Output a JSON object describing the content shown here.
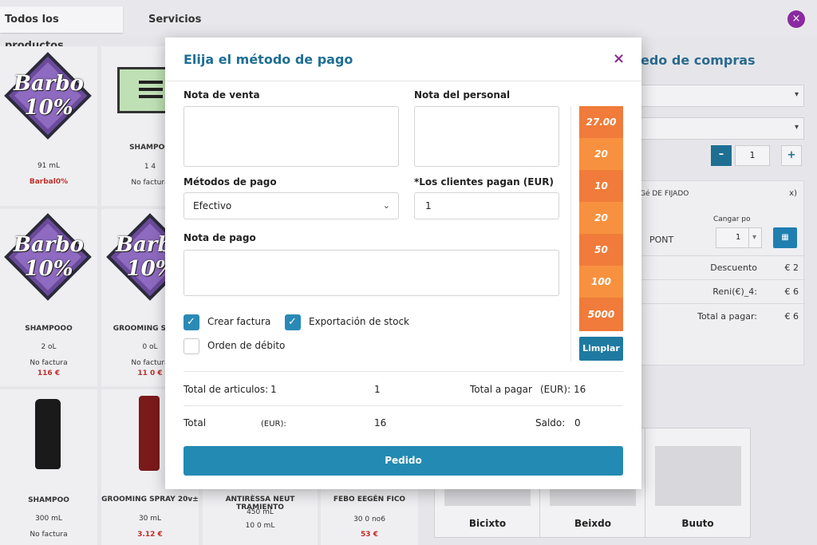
{
  "background": {
    "tabs": [
      "Todos los productos",
      "Servicios"
    ],
    "close_glyph": "×",
    "products": [
      {
        "name": "",
        "logo": "Barbo 10%",
        "size": "91 mL",
        "price": "Barbal0%"
      },
      {
        "name": "SHAMPOO",
        "size": "1 4",
        "note": "No factura"
      },
      {
        "name": "SHAMPOOO",
        "logo": "Barbo 10%",
        "size": "2 oL",
        "note": "No factura",
        "price": "116 €"
      },
      {
        "name": "GROOMING SPRAY",
        "logo": "Barbo 10%",
        "size": "0 oL",
        "note": "No factura",
        "price": "11 0 €"
      },
      {
        "name": "SHAMPOO",
        "size": "300 mL",
        "note": "No factura"
      },
      {
        "name": "GROOMING SPRAY 20v±",
        "size": "30 mL",
        "price": "3.12 €"
      },
      {
        "name": "ANTIRÈSSA NEUT TRAMIENTO",
        "size": "450 mL",
        "size2": "10 0 mL"
      },
      {
        "name": "FEBO EEGÉN FICO",
        "size": "30 0 no6",
        "price": "53 €"
      }
    ],
    "cart": {
      "title": "edo de compras",
      "qty": "1",
      "minus": "–",
      "plus": "+",
      "item_name": "Gé DE FIJADO",
      "item_close": "x)",
      "charge_label": "Cangar po",
      "unit": "PONT",
      "charge_qty": "1",
      "discount_label": "Descuento",
      "discount_value": "€ 2",
      "renta_label": "Reni(€)_4:",
      "renta_value": "€ 6",
      "total_label": "Total a pagar:",
      "total_value": "€ 6"
    },
    "categories": [
      "Bicixto",
      "Beixdo",
      "Buuto"
    ]
  },
  "modal": {
    "title": "Elija el método de pago",
    "close_glyph": "×",
    "sale_note_label": "Nota de venta",
    "staff_note_label": "Nota del personal",
    "payment_methods_label": "Métodos de pago",
    "payment_method_value": "Efectivo",
    "clients_pay_label": "*Los clientes pagan (EUR)",
    "clients_pay_value": "1",
    "payment_note_label": "Nota de pago",
    "checkboxes": [
      {
        "label": "Crear factura",
        "checked": true
      },
      {
        "label": "Exportación de stock",
        "checked": true
      },
      {
        "label": "Orden de débito",
        "checked": false
      }
    ],
    "cash_buttons": [
      "27.00",
      "20",
      "10",
      "20",
      "50",
      "100",
      "5000"
    ],
    "cash_colors": [
      "#f07b3a",
      "#f7913f",
      "#f07b3a",
      "#f7913f",
      "#f07b3a",
      "#f7913f",
      "#f07b3a"
    ],
    "clear_label": "Limplar",
    "summary": {
      "items_label": "Total de articulos:",
      "items_value": "1",
      "qty_value": "1",
      "to_pay_label": "Total a pagar",
      "to_pay_unit": "(EUR):",
      "to_pay_value": "16",
      "total_label": "Total",
      "total_unit": "(EUR):",
      "total_value": "16",
      "balance_label": "Saldo:",
      "balance_value": "0"
    },
    "order_label": "Pedido"
  }
}
